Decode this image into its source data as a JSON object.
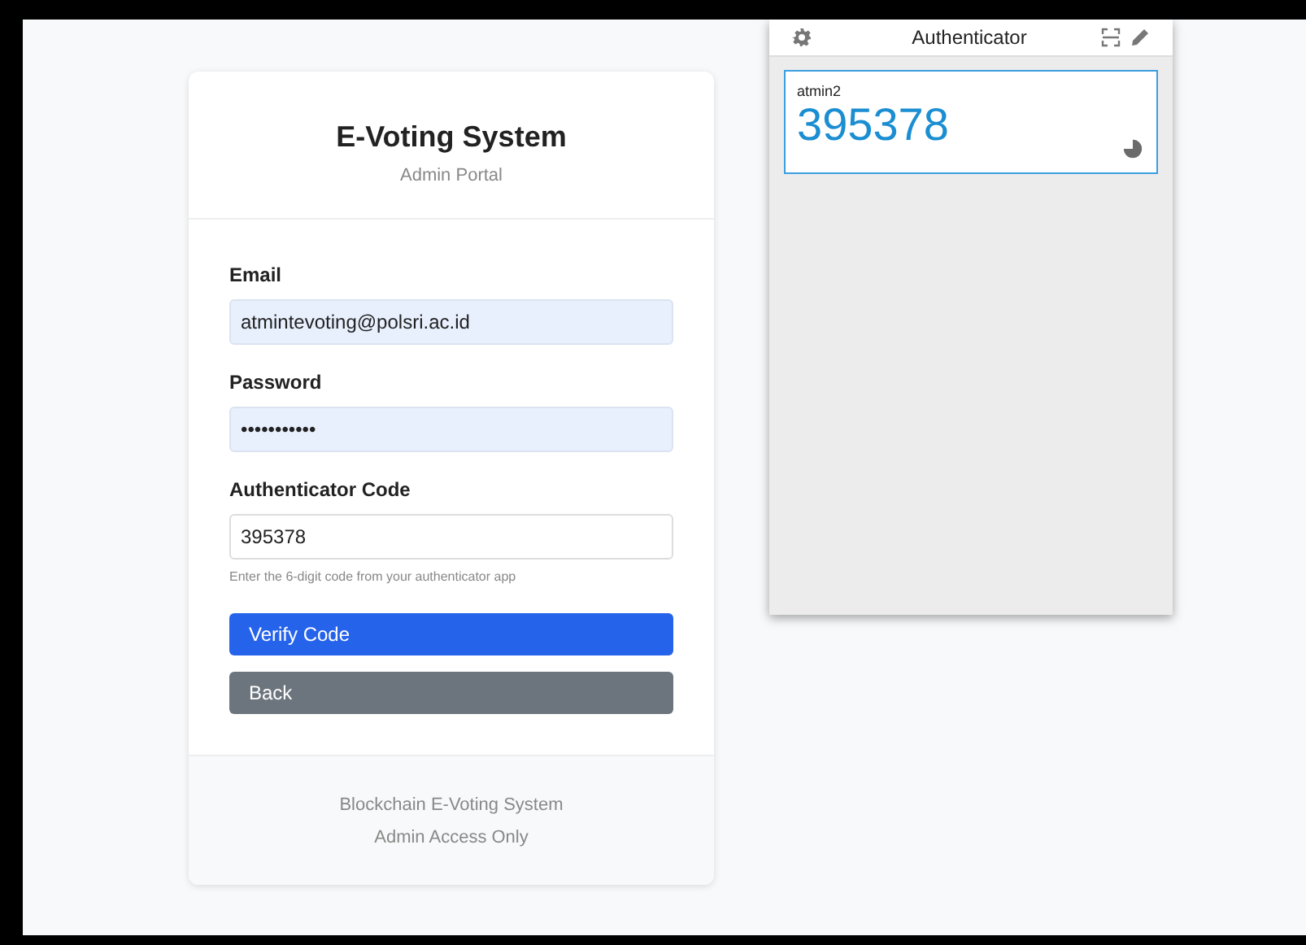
{
  "login_card": {
    "title": "E-Voting System",
    "subtitle": "Admin Portal",
    "fields": [
      {
        "label": "Email",
        "value": "atmintevoting@polsri.ac.id",
        "autofilled": true
      },
      {
        "label": "Password",
        "value": "•••••••••••",
        "autofilled": true
      },
      {
        "label": "Authenticator Code",
        "value": "395378",
        "autofilled": false,
        "hint": "Enter the 6-digit code from your authenticator app"
      }
    ],
    "buttons": [
      {
        "label": "Verify Code",
        "kind": "primary"
      },
      {
        "label": "Back",
        "kind": "secondary"
      }
    ],
    "footer": [
      "Blockchain E-Voting System",
      "Admin Access Only"
    ]
  },
  "authenticator": {
    "title": "Authenticator",
    "accounts": [
      {
        "name": "atmin2",
        "code": "395378",
        "selected": true
      }
    ]
  }
}
